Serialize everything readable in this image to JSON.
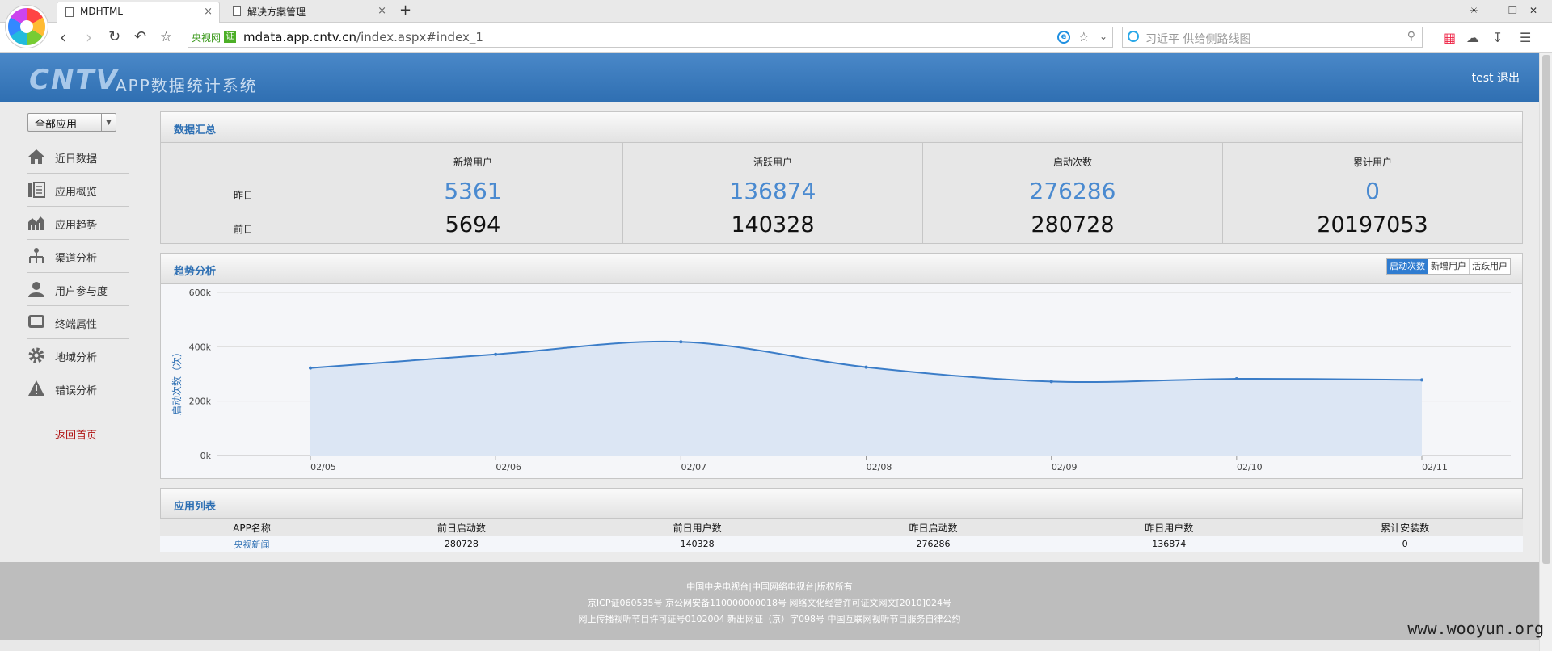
{
  "browser": {
    "tabs": [
      {
        "label": "MDHTML",
        "close": "×"
      },
      {
        "label": "解决方案管理",
        "close": "×"
      }
    ],
    "new_tab": "+",
    "site_label": "央视网",
    "cert": "证",
    "url_host": "mdata.app.cntv.cn",
    "url_path": "/index.aspx#index_1",
    "search_placeholder": "习近平 供给侧路线图"
  },
  "header": {
    "logo": "CNTV",
    "title": "APP数据统计系统",
    "user": "test",
    "logout": "退出"
  },
  "sidebar": {
    "app_select": "全部应用",
    "items": [
      {
        "label": "近日数据",
        "icon": "home-icon"
      },
      {
        "label": "应用概览",
        "icon": "book-icon"
      },
      {
        "label": "应用趋势",
        "icon": "bar-chart-icon"
      },
      {
        "label": "渠道分析",
        "icon": "hierarchy-icon"
      },
      {
        "label": "用户参与度",
        "icon": "user-icon"
      },
      {
        "label": "终端属性",
        "icon": "monitor-icon"
      },
      {
        "label": "地域分析",
        "icon": "gear-icon"
      },
      {
        "label": "错误分析",
        "icon": "warning-icon"
      }
    ],
    "home_link": "返回首页"
  },
  "summary": {
    "title": "数据汇总",
    "row_labels": {
      "yesterday": "昨日",
      "before": "前日"
    },
    "columns": [
      {
        "head": "新增用户",
        "yesterday": "5361",
        "before": "5694"
      },
      {
        "head": "活跃用户",
        "yesterday": "136874",
        "before": "140328"
      },
      {
        "head": "启动次数",
        "yesterday": "276286",
        "before": "280728"
      },
      {
        "head": "累计用户",
        "yesterday": "0",
        "before": "20197053"
      }
    ]
  },
  "trend": {
    "title": "趋势分析",
    "switches": [
      {
        "label": "启动次数",
        "active": true
      },
      {
        "label": "新增用户",
        "active": false
      },
      {
        "label": "活跃用户",
        "active": false
      }
    ]
  },
  "chart_data": {
    "type": "area",
    "x": [
      "02/05",
      "02/06",
      "02/07",
      "02/08",
      "02/09",
      "02/10",
      "02/11"
    ],
    "series": [
      {
        "values": [
          322000,
          372000,
          418000,
          325000,
          272000,
          282000,
          278000
        ]
      }
    ],
    "ylabel": "启动次数（次）",
    "yticks": [
      "0k",
      "200k",
      "400k",
      "600k"
    ],
    "ylim": [
      0,
      600000
    ],
    "grid": true,
    "colors": {
      "line": "#3b7dc8",
      "fill": "#dce6f4"
    }
  },
  "app_list": {
    "title": "应用列表",
    "headers": [
      "APP名称",
      "前日启动数",
      "前日用户数",
      "昨日启动数",
      "昨日用户数",
      "累计安装数"
    ],
    "rows": [
      [
        "央视新闻",
        "280728",
        "140328",
        "276286",
        "136874",
        "0"
      ]
    ]
  },
  "footer": {
    "lines": [
      "中国中央电视台|中国网络电视台|版权所有",
      "京ICP证060535号 京公网安备110000000018号 网络文化经营许可证文网文[2010]024号",
      "网上传播视听节目许可证号0102004 新出网证（京）字098号 中国互联网视听节目服务自律公约"
    ],
    "watermark": "www.wooyun.org"
  }
}
